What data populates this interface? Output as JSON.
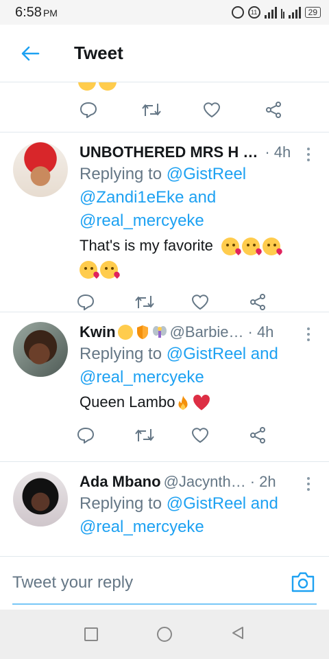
{
  "status_bar": {
    "time": "6:58",
    "ampm": "PM",
    "battery": "29",
    "alarm_badge": "11"
  },
  "header": {
    "title": "Tweet"
  },
  "tweets": [
    {
      "name": "UNBOTHERED MRS H …",
      "handle": "",
      "time": "· 4h",
      "replying_prefix": "Replying to ",
      "replying_line1": "@GistReel",
      "replying_line2": "@Zandi1eEke and",
      "replying_line3": "@real_mercyeke",
      "text": "That's is my favorite"
    },
    {
      "name": "Kwin",
      "handle": "@Barbie…",
      "time": "· 4h",
      "replying_prefix": "Replying to ",
      "replying_line1": "@GistReel and",
      "replying_line2": "@real_mercyeke",
      "text": "Queen Lambo"
    },
    {
      "name": "Ada Mbano",
      "handle": "@Jacynth…",
      "time": "· 2h",
      "replying_prefix": "Replying to ",
      "replying_line1": "@GistReel and",
      "replying_line2": "@real_mercyeke",
      "text": ""
    }
  ],
  "compose": {
    "placeholder": "Tweet your reply"
  },
  "colors": {
    "accent": "#1da1f2",
    "secondary": "#657786",
    "icon": "#657786"
  }
}
